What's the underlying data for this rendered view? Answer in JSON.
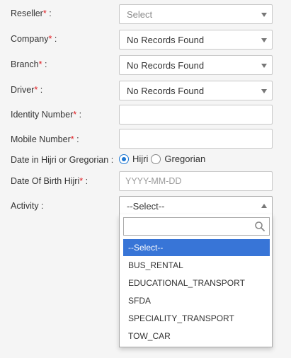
{
  "form": {
    "reseller": {
      "label": "Reseller",
      "req": "*",
      "colon": " :",
      "value": "Select"
    },
    "company": {
      "label": "Company",
      "req": "*",
      "colon": " :",
      "value": "No Records Found"
    },
    "branch": {
      "label": "Branch",
      "req": "*",
      "colon": " :",
      "value": "No Records Found"
    },
    "driver": {
      "label": "Driver",
      "req": "*",
      "colon": " :",
      "value": "No Records Found"
    },
    "identity": {
      "label": "Identity Number",
      "req": "*",
      "colon": " :",
      "value": ""
    },
    "mobile": {
      "label": "Mobile Number",
      "req": "*",
      "colon": " :",
      "value": ""
    },
    "date_type": {
      "label": "Date in Hijri or Gregorian :",
      "options": [
        "Hijri",
        "Gregorian"
      ],
      "selected": "Hijri"
    },
    "dob": {
      "label": "Date Of Birth Hijri",
      "req": "*",
      "colon": " :",
      "placeholder": "YYYY-MM-DD"
    },
    "activity": {
      "label": "Activity :",
      "value": "--Select--",
      "search_value": "",
      "options": [
        "--Select--",
        "BUS_RENTAL",
        "EDUCATIONAL_TRANSPORT",
        "SFDA",
        "SPECIALITY_TRANSPORT",
        "TOW_CAR"
      ],
      "highlighted_index": 0
    }
  },
  "colors": {
    "required": "#e0191e",
    "highlight": "#3875d7",
    "radio": "#1e77d2"
  },
  "icons": {
    "select_caret": "caret-down-icon",
    "activity_caret": "caret-up-icon",
    "search": "search-icon"
  }
}
